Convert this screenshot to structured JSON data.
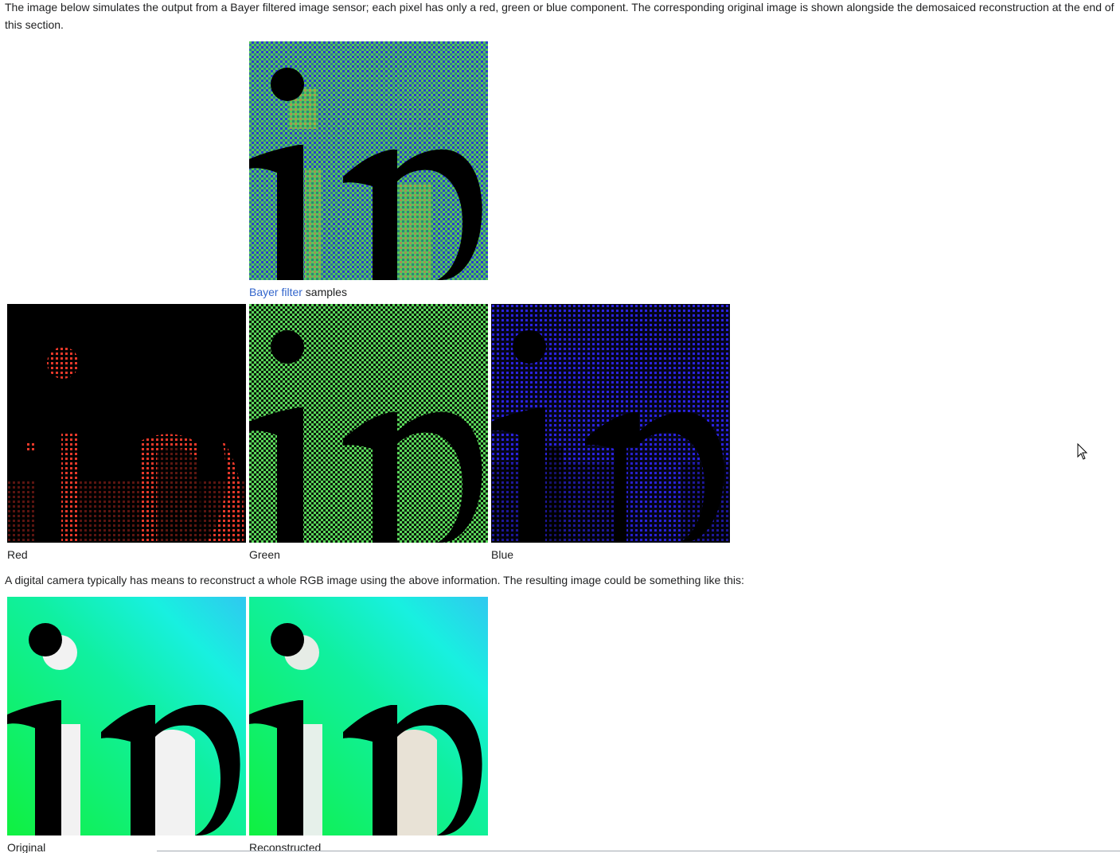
{
  "intro_text": "The image below simulates the output from a Bayer filtered image sensor; each pixel has only a red, green or blue component. The corresponding original image is shown alongside the demosaiced reconstruction at the end of this section.",
  "outro_text": "A digital camera typically has means to reconstruct a whole RGB image using the above information. The resulting image could be something like this:",
  "figures": {
    "bayer": {
      "caption_link": "Bayer filter",
      "caption_rest": " samples"
    },
    "red": {
      "caption": "Red"
    },
    "green": {
      "caption": "Green"
    },
    "blue": {
      "caption": "Blue"
    },
    "original": {
      "caption": "Original"
    },
    "reconstructed": {
      "caption": "Reconstructed"
    }
  },
  "colors": {
    "link": "#3366cc",
    "text": "#202122",
    "bayer_green": "#3c9a3c",
    "red_channel": "#e6392a",
    "green_channel": "#4cd04c",
    "blue_channel": "#2a22e0",
    "original_green": "#10f040",
    "original_cyan": "#20d8f0"
  },
  "icons": {
    "cursor": "mouse-pointer-icon"
  }
}
